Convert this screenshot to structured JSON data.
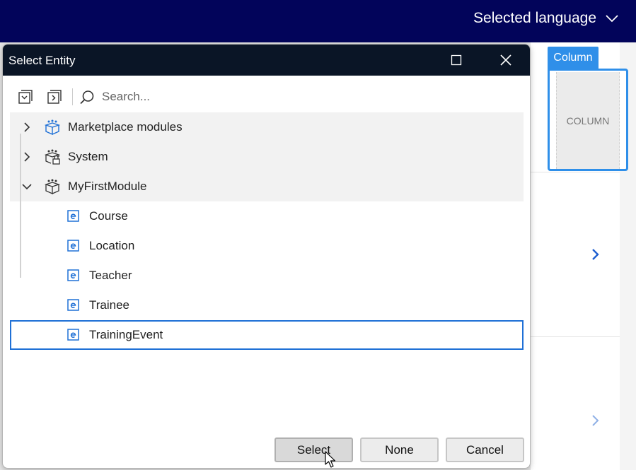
{
  "topbar": {
    "language_label": "Selected language"
  },
  "canvas": {
    "column_tag": "Column",
    "column_placeholder": "COLUMN"
  },
  "dialog": {
    "title": "Select Entity",
    "search": {
      "placeholder": "Search...",
      "value": ""
    },
    "tree": {
      "modules": [
        {
          "label": "Marketplace modules",
          "expanded": false,
          "icon": "module-box-icon"
        },
        {
          "label": "System",
          "expanded": false,
          "icon": "system-module-lock-icon"
        },
        {
          "label": "MyFirstModule",
          "expanded": true,
          "icon": "module-box-icon"
        }
      ],
      "entities": [
        "Course",
        "Location",
        "Teacher",
        "Trainee",
        "TrainingEvent"
      ],
      "selected_entity": "TrainingEvent"
    },
    "buttons": {
      "select": "Select",
      "none": "None",
      "cancel": "Cancel"
    }
  },
  "colors": {
    "topbar": "#02045a",
    "titlebar": "#0a1526",
    "accent": "#2f8fe9",
    "selection": "#1f70d6",
    "entity_icon": "#1f70d6"
  }
}
